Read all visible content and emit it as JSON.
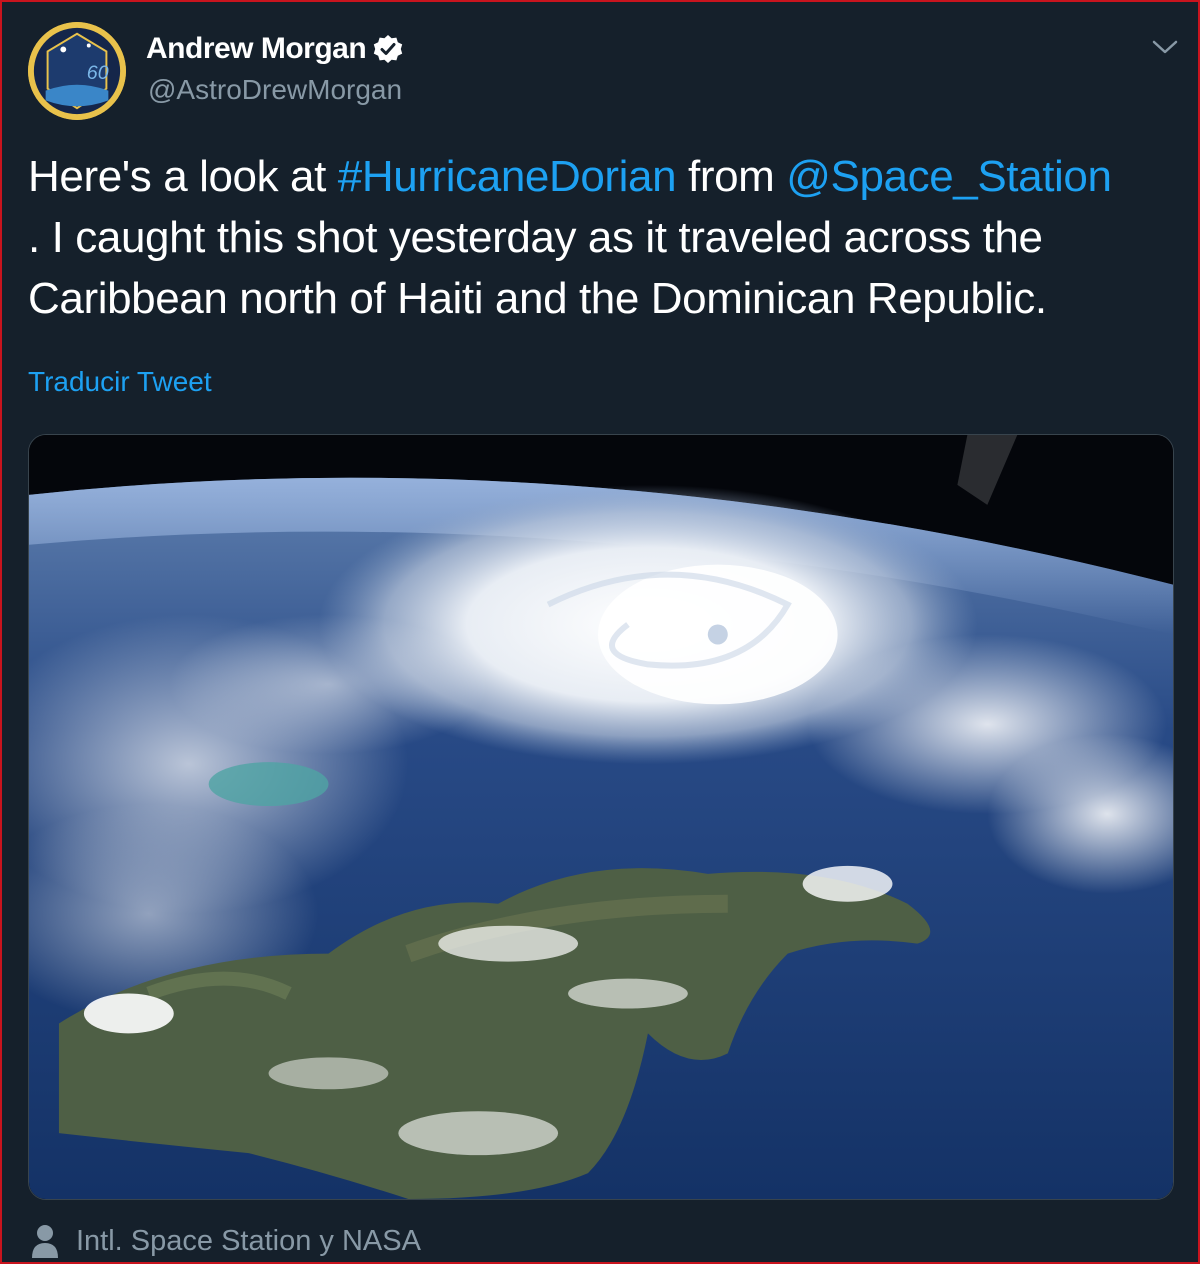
{
  "author": {
    "name": "Andrew Morgan",
    "handle": "@AstroDrewMorgan",
    "verified": true,
    "avatar_icon": "expedition-60-patch-icon",
    "avatar_text": "60"
  },
  "tweet": {
    "text_before_hashtag": "Here's a look at ",
    "hashtag": "#HurricaneDorian",
    "text_between": " from ",
    "mention": "@Space_Station",
    "text_after": ". I caught this shot yesterday as it traveled across the Caribbean north of Haiti and the Dominican Republic.",
    "translate_label": "Traducir Tweet"
  },
  "media": {
    "image_icon": "earth-hurricane-photo"
  },
  "tagged": {
    "icon": "person-icon",
    "label": "Intl. Space Station y NASA"
  },
  "colors": {
    "background": "#15202b",
    "link": "#1da1f2",
    "secondary_text": "#8899a6",
    "window_border": "#c8141e"
  }
}
